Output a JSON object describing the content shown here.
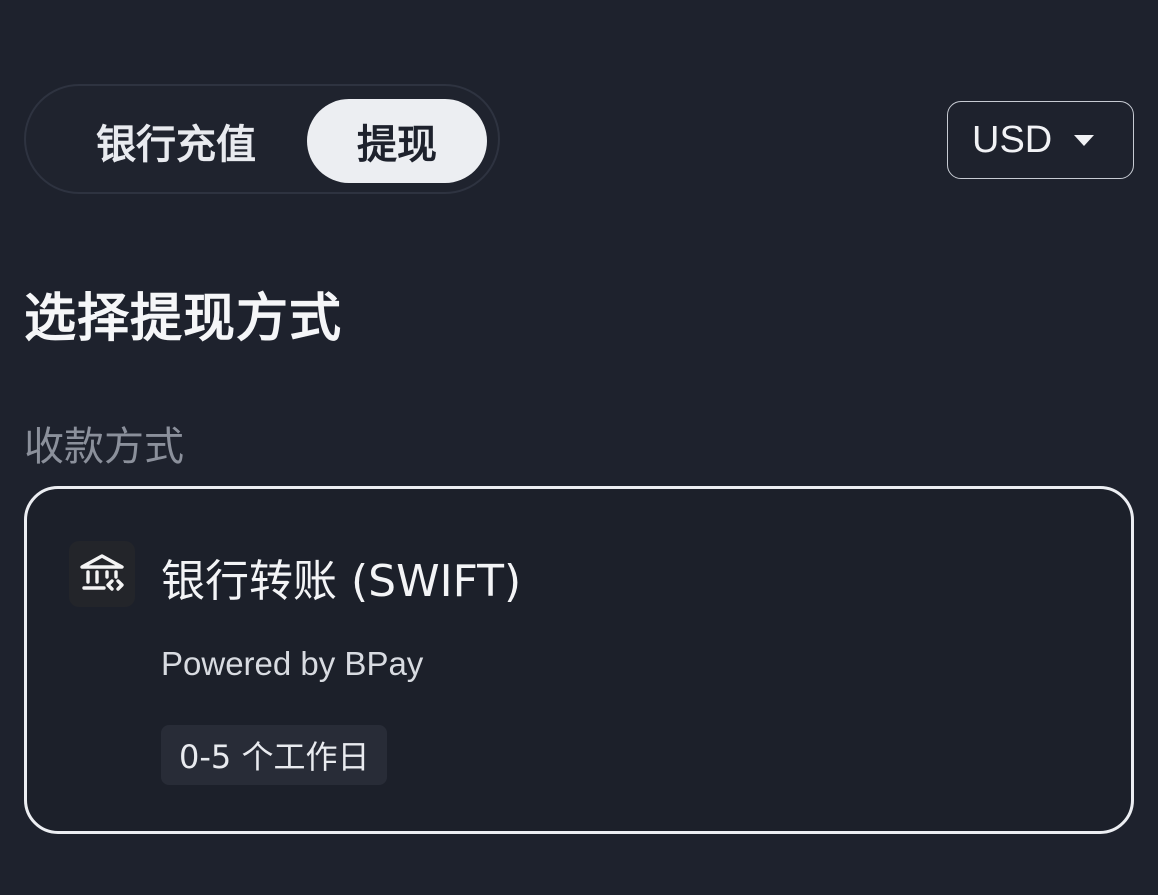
{
  "tabs": {
    "deposit_label": "银行充值",
    "withdraw_label": "提现",
    "active": "withdraw"
  },
  "currency": {
    "value": "USD",
    "icon": "caret-down-icon"
  },
  "page_title": "选择提现方式",
  "section_label": "收款方式",
  "method": {
    "icon": "bank-icon",
    "title": "银行转账 (SWIFT)",
    "subtitle": "Powered by BPay",
    "badge": "0-5 个工作日"
  },
  "colors": {
    "background": "#1e222d",
    "active_tab": "#eceef2",
    "card_border": "#eceef2",
    "muted_text": "#8b909b"
  }
}
